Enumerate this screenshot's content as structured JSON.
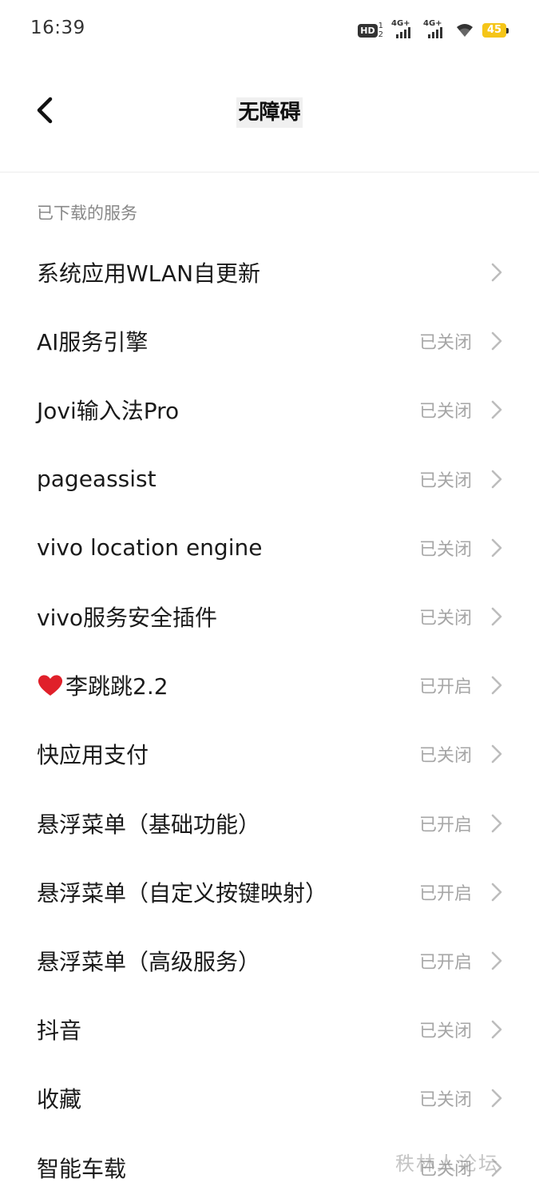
{
  "status_bar": {
    "time": "16:39",
    "hd_label": "HD",
    "hd_top": "1",
    "hd_bottom": "2",
    "signal1_label": "4G+",
    "signal2_label": "4G+",
    "battery_level": "45",
    "battery_color": "#f5c518"
  },
  "header": {
    "back_icon": "chevron-left-icon",
    "title": "无障碍"
  },
  "section": {
    "title": "已下载的服务"
  },
  "items": [
    {
      "label": "系统应用WLAN自更新",
      "status": ""
    },
    {
      "label": "AI服务引擎",
      "status": "已关闭"
    },
    {
      "label": "Jovi输入法Pro",
      "status": "已关闭"
    },
    {
      "label": "pageassist",
      "status": "已关闭"
    },
    {
      "label": "vivo location engine",
      "status": "已关闭"
    },
    {
      "label": "vivo服务安全插件",
      "status": "已关闭"
    },
    {
      "label": "李跳跳2.2",
      "status": "已开启",
      "icon": "heart-icon"
    },
    {
      "label": "快应用支付",
      "status": "已关闭"
    },
    {
      "label": "悬浮菜单（基础功能）",
      "status": "已开启"
    },
    {
      "label": "悬浮菜单（自定义按键映射）",
      "status": "已开启"
    },
    {
      "label": "悬浮菜单（高级服务）",
      "status": "已开启"
    },
    {
      "label": "抖音",
      "status": "已关闭"
    },
    {
      "label": "收藏",
      "status": "已关闭"
    },
    {
      "label": "智能车载",
      "status": "已关闭"
    }
  ],
  "watermark": "秩林人论坛"
}
